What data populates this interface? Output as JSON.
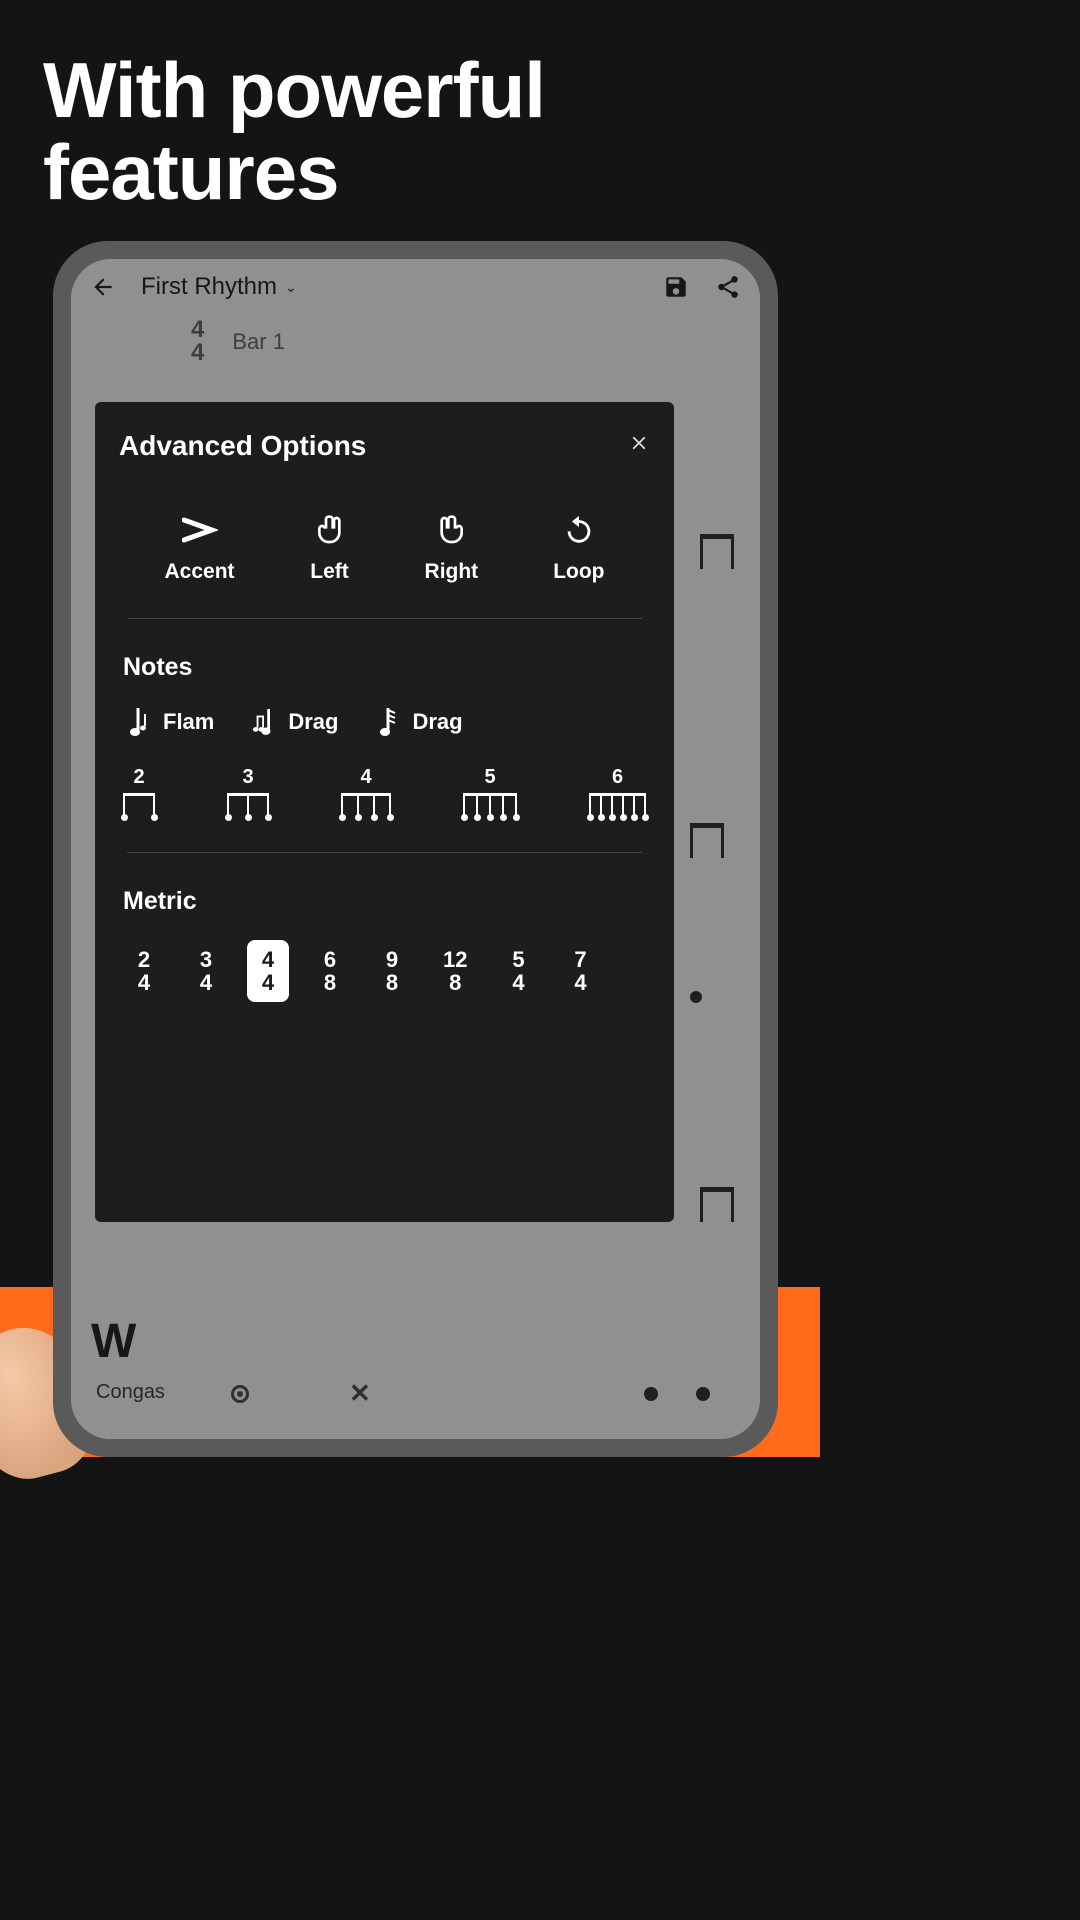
{
  "promo": {
    "title": "With powerful features"
  },
  "app": {
    "header": {
      "project_title": "First Rhythm",
      "time_signature_top": "4",
      "time_signature_bottom": "4",
      "bar_label": "Bar 1"
    },
    "instrument": {
      "label": "Congas"
    }
  },
  "modal": {
    "title": "Advanced Options",
    "options": {
      "accent": "Accent",
      "left": "Left",
      "right": "Right",
      "loop": "Loop"
    },
    "notes_section": "Notes",
    "notes": {
      "flam": "Flam",
      "drag1": "Drag",
      "drag2": "Drag"
    },
    "tuplets": [
      "2",
      "3",
      "4",
      "5",
      "6"
    ],
    "metric_section": "Metric",
    "metrics": [
      {
        "top": "2",
        "bottom": "4",
        "selected": false
      },
      {
        "top": "3",
        "bottom": "4",
        "selected": false
      },
      {
        "top": "4",
        "bottom": "4",
        "selected": true
      },
      {
        "top": "6",
        "bottom": "8",
        "selected": false
      },
      {
        "top": "9",
        "bottom": "8",
        "selected": false
      },
      {
        "top": "12",
        "bottom": "8",
        "selected": false
      },
      {
        "top": "5",
        "bottom": "4",
        "selected": false
      },
      {
        "top": "7",
        "bottom": "4",
        "selected": false
      }
    ]
  }
}
